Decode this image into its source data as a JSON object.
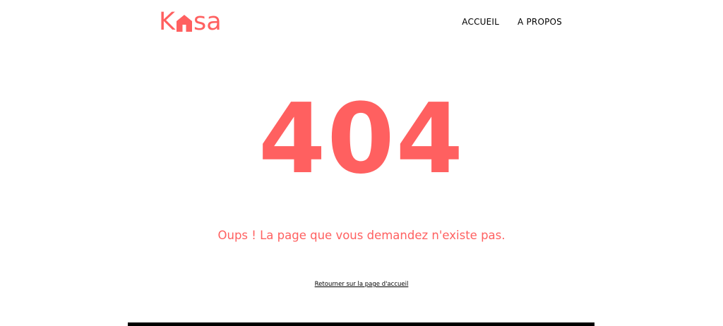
{
  "brand": {
    "logo_before": "K",
    "logo_after": "sa",
    "logo_icon": "house-icon",
    "accent_color": "#ff6060"
  },
  "nav": {
    "items": [
      {
        "label": "ACCUEIL"
      },
      {
        "label": "A PROPOS"
      }
    ]
  },
  "error": {
    "code": "404",
    "message": "Oups ! La page que vous demandez n'existe pas.",
    "back_link": "Retourner sur la page d'accueil"
  },
  "footer": {
    "color": "#000000"
  }
}
